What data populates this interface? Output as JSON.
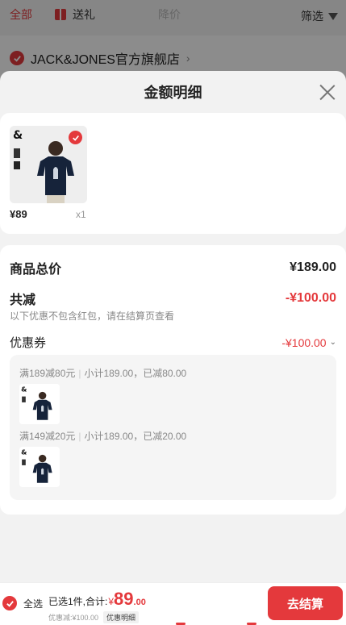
{
  "bg": {
    "tabs": [
      "全部",
      "送礼",
      "降价"
    ],
    "filter_label": "筛选",
    "store_name": "JACK&JONES官方旗舰店",
    "store_chevron": "›"
  },
  "sheet": {
    "title": "金额明细"
  },
  "product": {
    "image_icon": "tshirt-product-image",
    "price": "¥89",
    "qty": "x1"
  },
  "summary": {
    "total_label": "商品总价",
    "total_value": "¥189.00",
    "discount_label": "共减",
    "discount_value": "-¥100.00",
    "discount_note": "以下优惠不包含红包，请在结算页查看",
    "coupon_label": "优惠券",
    "coupon_value": "-¥100.00"
  },
  "coupons": [
    {
      "rule": "满189减80元",
      "detail": "小计189.00，已减80.00"
    },
    {
      "rule": "满149减20元",
      "detail": "小计189.00，已减20.00"
    }
  ],
  "bottom": {
    "select_all": "全选",
    "summary_prefix": "已选1件,合计:",
    "currency": "¥",
    "amount_int": "89",
    "amount_dec": ".00",
    "discount_text": "优惠减:¥100.00",
    "detail_chip": "优惠明细",
    "checkout": "去结算"
  },
  "colors": {
    "accent": "#e4393c"
  }
}
